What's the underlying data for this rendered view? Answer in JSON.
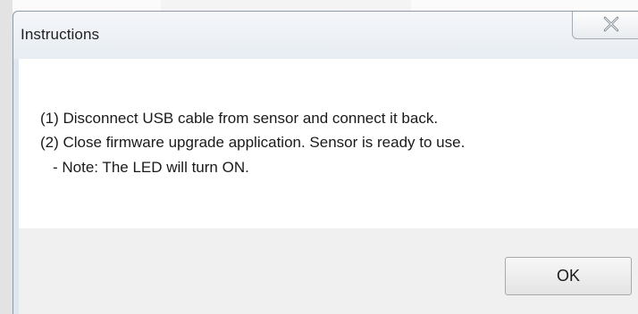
{
  "dialog": {
    "title": "Instructions",
    "close_icon": "close-x-icon"
  },
  "background": {
    "ghost_button_label": "Close"
  },
  "message": {
    "lines": [
      "(1) Disconnect USB cable from sensor and connect it back.",
      "(2) Close firmware upgrade application. Sensor is ready to use.",
      "- Note: The LED will turn ON."
    ]
  },
  "buttons": {
    "ok_label": "OK"
  }
}
